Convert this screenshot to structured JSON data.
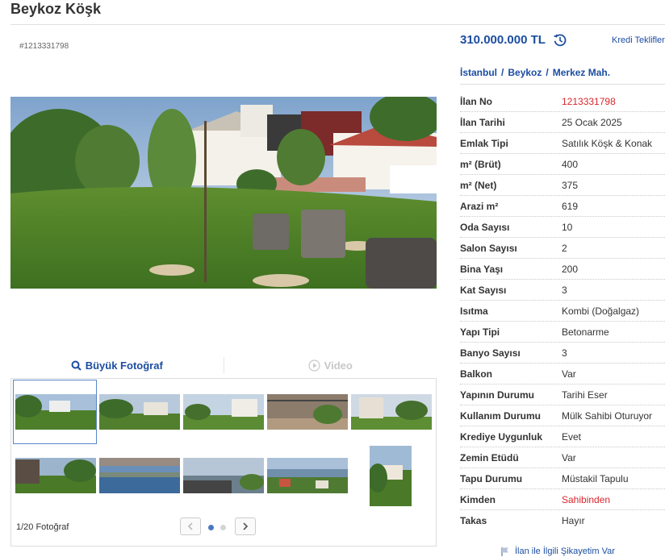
{
  "listing": {
    "title": "Beykoz Köşk",
    "ad_id": "#1213331798",
    "price": "310.000.000 TL",
    "credit_link": "Kredi Teklifleri",
    "breadcrumb": [
      "İstanbul",
      "Beykoz",
      "Merkez Mah."
    ]
  },
  "media": {
    "tab_photo": "Büyük Fotoğraf",
    "tab_video": "Video",
    "counter": "1/20 Fotoğraf"
  },
  "details": [
    {
      "key": "İlan No",
      "value": "1213331798",
      "color": "#d9262c"
    },
    {
      "key": "İlan Tarihi",
      "value": "25 Ocak 2025"
    },
    {
      "key": "Emlak Tipi",
      "value": "Satılık Köşk & Konak"
    },
    {
      "key": "m² (Brüt)",
      "value": "400"
    },
    {
      "key": "m² (Net)",
      "value": "375"
    },
    {
      "key": "Arazi m²",
      "value": "619"
    },
    {
      "key": "Oda Sayısı",
      "value": "10"
    },
    {
      "key": "Salon Sayısı",
      "value": "2"
    },
    {
      "key": "Bina Yaşı",
      "value": "200"
    },
    {
      "key": "Kat Sayısı",
      "value": "3"
    },
    {
      "key": "Isıtma",
      "value": "Kombi (Doğalgaz)"
    },
    {
      "key": "Yapı Tipi",
      "value": "Betonarme"
    },
    {
      "key": "Banyo Sayısı",
      "value": "3"
    },
    {
      "key": "Balkon",
      "value": "Var"
    },
    {
      "key": "Yapının Durumu",
      "value": "Tarihi Eser"
    },
    {
      "key": "Kullanım Durumu",
      "value": "Mülk Sahibi Oturuyor"
    },
    {
      "key": "Krediye Uygunluk",
      "value": "Evet"
    },
    {
      "key": "Zemin Etüdü",
      "value": "Var"
    },
    {
      "key": "Tapu Durumu",
      "value": "Müstakil Tapulu"
    },
    {
      "key": "Kimden",
      "value": "Sahibinden",
      "color": "#d9262c"
    },
    {
      "key": "Takas",
      "value": "Hayır"
    }
  ],
  "complaint_link": "İlan ile İlgili Şikayetim Var",
  "icons": {
    "photo_tab": "search-icon",
    "video_tab": "play-icon",
    "price_history": "history-icon",
    "complaint": "flag-icon",
    "prev": "chevron-left-icon",
    "next": "chevron-right-icon"
  },
  "colors": {
    "accent": "#1c4da1",
    "highlight": "#d9262c"
  }
}
